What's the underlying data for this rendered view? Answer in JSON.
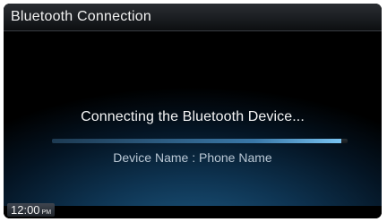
{
  "header": {
    "title": "Bluetooth Connection"
  },
  "main": {
    "status_message": "Connecting the Bluetooth Device...",
    "progress_fraction": 0.98,
    "device_line": "Device Name : Phone Name"
  },
  "status_bar": {
    "time": "12:00",
    "ampm": "PM"
  },
  "colors": {
    "accent": "#3a78a8",
    "glow": "#1f5c86"
  }
}
